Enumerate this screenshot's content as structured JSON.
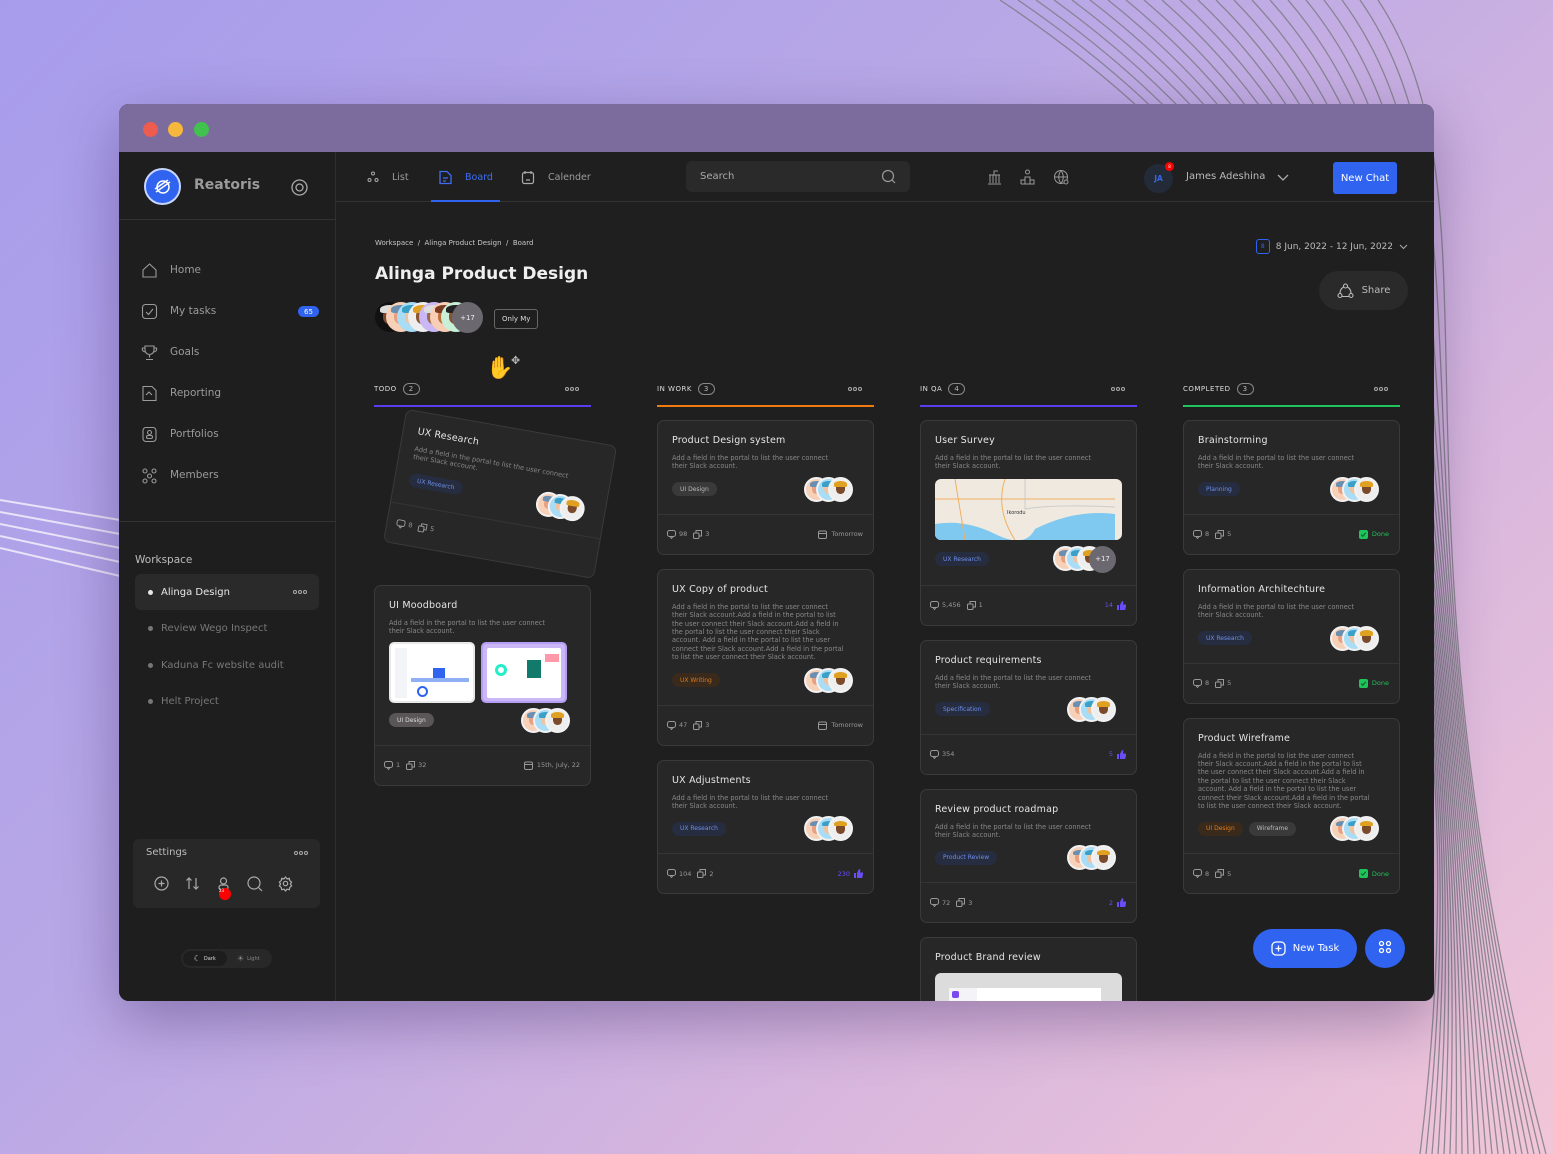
{
  "window": {
    "controls": [
      {
        "name": "close",
        "color": "#ee5b4f"
      },
      {
        "name": "minimize",
        "color": "#f5b73c"
      },
      {
        "name": "maximize",
        "color": "#41c14d"
      }
    ]
  },
  "sidebar": {
    "brand": "Reatoris",
    "nav": [
      {
        "label": "Home",
        "icon": "home-icon"
      },
      {
        "label": "My tasks",
        "icon": "checkbox-icon",
        "badge": "65"
      },
      {
        "label": "Goals",
        "icon": "trophy-icon"
      },
      {
        "label": "Reporting",
        "icon": "report-icon"
      },
      {
        "label": "Portfolios",
        "icon": "portfolio-icon"
      },
      {
        "label": "Members",
        "icon": "members-icon"
      }
    ],
    "workspace_title": "Workspace",
    "workspaces": [
      {
        "label": "Alinga Design",
        "active": true
      },
      {
        "label": "Review Wego Inspect"
      },
      {
        "label": "Kaduna Fc website audit"
      },
      {
        "label": "Helt Project"
      }
    ],
    "settings": {
      "label": "Settings",
      "icons": [
        "add-icon",
        "sort-icon",
        "user-icon",
        "search-icon",
        "gear-icon"
      ],
      "user_badge": "23"
    },
    "theme": {
      "dark": "Dark",
      "light": "Light",
      "selected": "Dark"
    }
  },
  "topbar": {
    "tabs": [
      {
        "label": "List",
        "icon": "list-icon"
      },
      {
        "label": "Board",
        "icon": "board-icon",
        "active": true
      },
      {
        "label": "Calender",
        "icon": "calendar-icon"
      }
    ],
    "search_placeholder": "Search",
    "icons": [
      "bank-icon",
      "podium-icon",
      "globe-search-icon"
    ],
    "user": {
      "initials": "JA",
      "name": "James Adeshina",
      "notification": "8"
    },
    "new_chat": "New Chat"
  },
  "page": {
    "breadcrumb": "Workspace  /  Alinga Product Design  /  Board",
    "title": "Alinga Product Design",
    "members_more": "+17",
    "only_my": "Only My",
    "date_range": "8 Jun, 2022 - 12 Jun, 2022",
    "date_icon_num": "8",
    "share": "Share"
  },
  "accent": "#2f63f0",
  "columns": [
    {
      "name": "TODO",
      "count": "2",
      "color": "#5b3df0",
      "cards": [
        {
          "title": "UX Research",
          "desc": "Add a field in the portal to list the user connect their Slack account.",
          "tags": [
            {
              "label": "UX Research",
              "kind": "blue"
            }
          ],
          "comments": "8",
          "subtasks": "5",
          "dragging": true
        },
        {
          "title": "UI Moodboard",
          "desc": "Add a field in the portal to list the user connect their Slack account.",
          "media": "moodboard",
          "tags": [
            {
              "label": "UI Design",
              "kind": "gray"
            }
          ],
          "comments": "1",
          "subtasks": "32",
          "right": {
            "type": "date",
            "value": "15th, July, 22"
          }
        }
      ]
    },
    {
      "name": "IN WORK",
      "count": "3",
      "color": "#f07a12",
      "cards": [
        {
          "title": "Product Design system",
          "desc": "Add a field in the portal to list the user connect their Slack account.",
          "tags": [
            {
              "label": "UI Design",
              "kind": "dark"
            }
          ],
          "comments": "98",
          "subtasks": "3",
          "right": {
            "type": "date",
            "value": "Tomorrow"
          }
        },
        {
          "title": "UX Copy of product",
          "desc": "Add a field in the portal to list the user connect their Slack account.Add a field in the portal to list the user connect their Slack account.Add a field in the portal to list the user connect their Slack account. Add a field in the portal to list the user connect their Slack account.Add a field in the portal to list the user connect their Slack account.",
          "tags": [
            {
              "label": "UX Writing",
              "kind": "orange"
            }
          ],
          "comments": "47",
          "subtasks": "3",
          "right": {
            "type": "date",
            "value": "Tomorrow"
          }
        },
        {
          "title": "UX Adjustments",
          "desc": "Add a field in the portal to list the user connect their Slack account.",
          "tags": [
            {
              "label": "UX Research",
              "kind": "blue"
            }
          ],
          "comments": "104",
          "subtasks": "2",
          "right": {
            "type": "likes",
            "value": "230"
          }
        }
      ]
    },
    {
      "name": "IN QA",
      "count": "4",
      "color": "#5b3df0",
      "cards": [
        {
          "title": "User Survey",
          "desc": "Add a field in the portal to list the user connect their Slack account.",
          "media": "map",
          "map_label": "Ikorodu",
          "tags": [
            {
              "label": "UX Research",
              "kind": "blue"
            }
          ],
          "more": "+17",
          "comments": "5,456",
          "subtasks": "1",
          "right": {
            "type": "likes",
            "value": "14"
          }
        },
        {
          "title": "Product requirements",
          "desc": "Add a field in the portal to list the user connect their Slack account.",
          "tags": [
            {
              "label": "Specification",
              "kind": "blue"
            }
          ],
          "comments": "354",
          "right": {
            "type": "likes",
            "value": "5"
          }
        },
        {
          "title": "Review product roadmap",
          "desc": "Add a field in the portal to list the user connect their Slack account.",
          "tags": [
            {
              "label": "Product Review",
              "kind": "blue"
            }
          ],
          "comments": "72",
          "subtasks": "3",
          "right": {
            "type": "likes",
            "value": "2"
          }
        },
        {
          "title": "Product Brand review",
          "media": "screenshot"
        }
      ]
    },
    {
      "name": "COMPLETED",
      "count": "3",
      "color": "#1fc45a",
      "cards": [
        {
          "title": "Brainstorming",
          "desc": "Add a field in the portal to list the user connect their Slack account.",
          "tags": [
            {
              "label": "Planning",
              "kind": "blue"
            }
          ],
          "comments": "8",
          "subtasks": "5",
          "right": {
            "type": "done",
            "value": "Done"
          }
        },
        {
          "title": "Information Architechture",
          "desc": "Add a field in the portal to list the user connect their Slack account.",
          "tags": [
            {
              "label": "UX Research",
              "kind": "blue"
            }
          ],
          "comments": "8",
          "subtasks": "5",
          "right": {
            "type": "done",
            "value": "Done"
          }
        },
        {
          "title": "Product Wireframe",
          "desc": "Add a field in the portal to list the user connect their Slack account.Add a field in the portal to list the user connect their Slack account.Add a field in the portal to list the user connect their Slack account. Add a field in the portal to list the user connect their Slack account.Add a field in the portal to list the user connect their Slack account.",
          "tags": [
            {
              "label": "UI Design",
              "kind": "orange"
            },
            {
              "label": "Wireframe",
              "kind": "dark"
            }
          ],
          "comments": "8",
          "subtasks": "5",
          "right": {
            "type": "done",
            "value": "Done"
          }
        }
      ]
    }
  ],
  "fab": {
    "new_task": "New Task"
  }
}
